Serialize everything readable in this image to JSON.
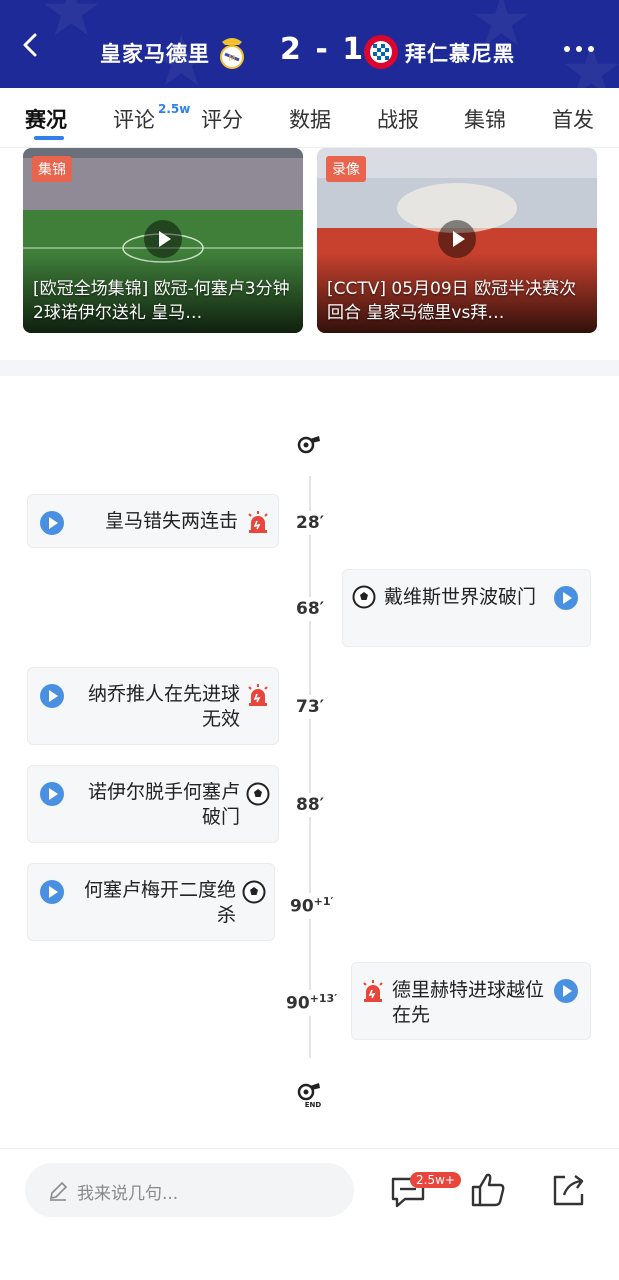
{
  "header": {
    "home_team": "皇家马德里",
    "away_team": "拜仁慕尼黑",
    "score": "2 - 1",
    "icons": {
      "back": "back-arrow-icon",
      "more": "more-dots-icon"
    },
    "colors": {
      "background": "#1e2a97"
    }
  },
  "tabs": {
    "items": [
      {
        "label": "赛况"
      },
      {
        "label": "评论"
      },
      {
        "label": "评分"
      },
      {
        "label": "数据"
      },
      {
        "label": "战报"
      },
      {
        "label": "集锦"
      },
      {
        "label": "首发"
      }
    ],
    "comment_badge": "2.5w",
    "active_index": 0,
    "accent": "#2f80ed"
  },
  "videos": [
    {
      "tag": "集锦",
      "title": "[欧冠全场集锦] 欧冠-何塞卢3分钟2球诺伊尔送礼 皇马…"
    },
    {
      "tag": "录像",
      "title": "[CCTV] 05月09日 欧冠半决赛次回合 皇家马德里vs拜…"
    }
  ],
  "timeline": {
    "events": [
      {
        "minute": "28′",
        "text": "皇马错失两连击",
        "side": "home",
        "icon": "alarm-icon"
      },
      {
        "minute": "68′",
        "text": "戴维斯世界波破门",
        "side": "away",
        "icon": "football-icon"
      },
      {
        "minute": "73′",
        "text": "纳乔推人在先进球无效",
        "side": "home",
        "icon": "alarm-icon"
      },
      {
        "minute": "88′",
        "text": "诺伊尔脱手何塞卢破门",
        "side": "home",
        "icon": "football-icon"
      },
      {
        "minute": "90",
        "extra": "+1′",
        "text": "何塞卢梅开二度绝杀",
        "side": "home",
        "icon": "football-icon"
      },
      {
        "minute": "90",
        "extra": "+13′",
        "text": "德里赫特进球越位在先",
        "side": "away",
        "icon": "alarm-icon"
      }
    ],
    "start_icon": "whistle-icon",
    "end_icon": "whistle-end-icon",
    "end_label": "END"
  },
  "bottom_bar": {
    "placeholder": "我来说几句...",
    "comment_count": "2.5w+",
    "icons": [
      "comment-icon",
      "thumbs-up-icon",
      "share-icon"
    ]
  }
}
